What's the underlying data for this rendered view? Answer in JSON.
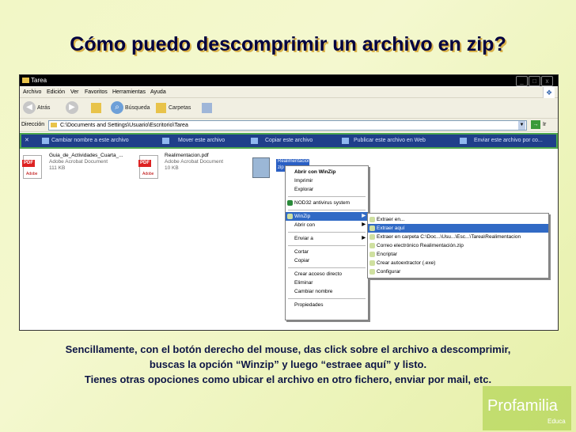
{
  "slide": {
    "title": "Cómo puedo descomprimir un archivo en zip?",
    "caption_line1": "Sencillamente, con el botón derecho del mouse, das click sobre el archivo a descomprimir,",
    "caption_line2": "buscas la opción “Winzip” y luego “estraee aquí” y listo.",
    "caption_line3": "Tienes otras opociones como ubicar el archivo en otro fichero, enviar por mail, etc.",
    "logo_text": "Profamilia",
    "logo_sub": "Educa"
  },
  "window": {
    "title": "Tarea",
    "controls": [
      "_",
      "□",
      "x"
    ],
    "menu": [
      "Archivo",
      "Edición",
      "Ver",
      "Favoritos",
      "Herramientas",
      "Ayuda"
    ]
  },
  "toolbar": {
    "back": "Atrás",
    "search": "Búsqueda",
    "folders": "Carpetas"
  },
  "address": {
    "label": "Dirección",
    "path": "C:\\Documents and Settings\\Usuario\\Escritorio\\Tarea",
    "go": "Ir"
  },
  "tasks": [
    "Cambiar nombre a este archivo",
    "Mover este archivo",
    "Copiar este archivo",
    "Publicar este archivo en Web",
    "Enviar este archivo por co..."
  ],
  "files": [
    {
      "name": "Guia_de_Actividades_Cuarta_...",
      "type": "Adobe Acrobat Document",
      "size": "111 KB",
      "badge": "PDF"
    },
    {
      "name": "Realimentacion.pdf",
      "type": "Adobe Acrobat Document",
      "size": "10 KB",
      "badge": "PDF"
    }
  ],
  "zip_file": {
    "name": "Realimentacion",
    "ext": "zip"
  },
  "context_menu": {
    "items": [
      "Abrir con WinZip",
      "Imprimir",
      "Explorar",
      "NOD32 antivirus system",
      "WinZip",
      "Abrir con",
      "Enviar a",
      "Cortar",
      "Copiar",
      "Crear acceso directo",
      "Eliminar",
      "Cambiar nombre",
      "Propiedades"
    ]
  },
  "winzip_submenu": {
    "items": [
      "Extraer en...",
      "Extraer aquí",
      "Extraer en carpeta C:\\Doc...\\Usu...\\Esc...\\Tarea\\Realimentacion",
      "Correo electrónico Realimentación.zip",
      "Encriptar",
      "Crear autoextractor (.exe)",
      "Configurar"
    ]
  },
  "colors": {
    "title_text": "#000040",
    "title_shadow": "#d9b24a",
    "highlight": "#316ac5",
    "taskbar": "#1f3f8a",
    "taskbar_border": "#4ea84e",
    "pdf_red": "#d22222"
  }
}
